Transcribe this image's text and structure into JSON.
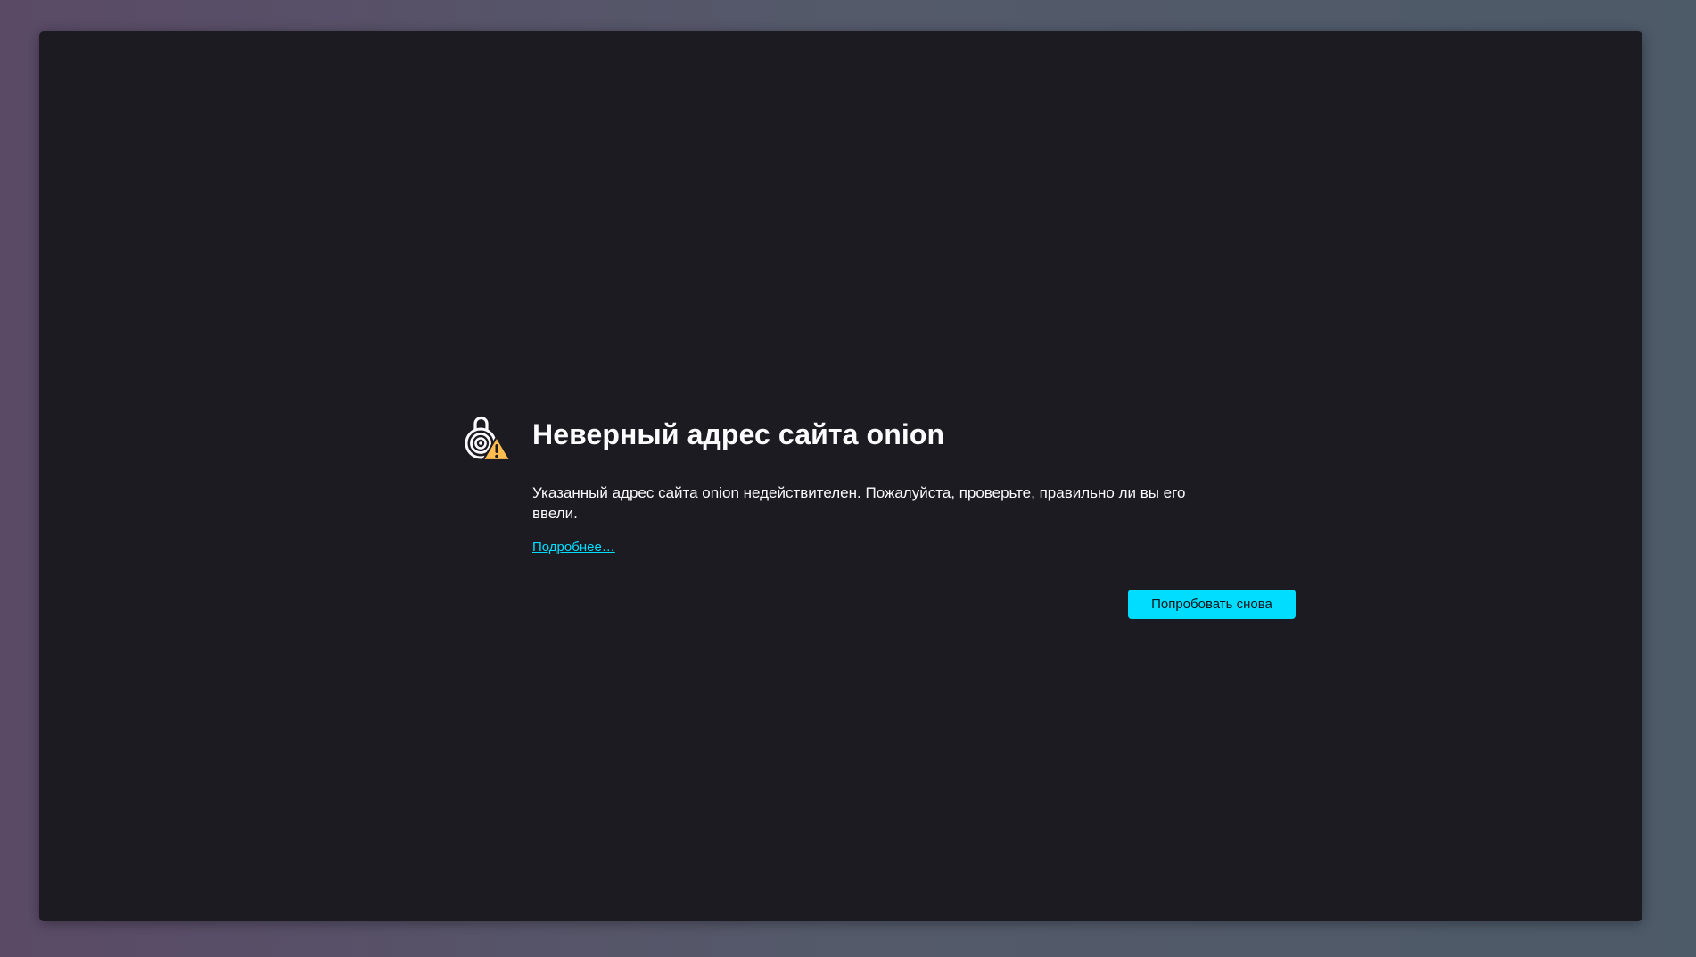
{
  "error": {
    "title": "Неверный адрес сайта onion",
    "description": "Указанный адрес сайта onion недействителен. Пожалуйста, проверьте, правильно ли вы его ввели.",
    "learn_more_label": "Подробнее…",
    "try_again_label": "Попробовать снова",
    "icon": "onion-lock-warning-icon"
  },
  "colors": {
    "page_background": "#1c1b22",
    "text": "#fbfbfe",
    "accent": "#00ddff",
    "warning": "#ffbd4f"
  }
}
